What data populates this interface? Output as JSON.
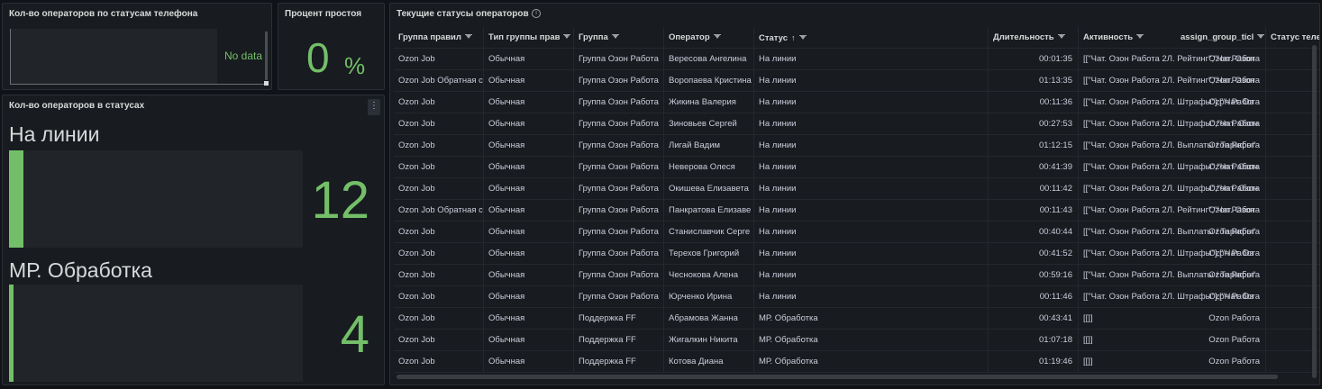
{
  "panels": {
    "phone_status": {
      "title": "Кол-во операторов по статусам телефона",
      "no_data": "No data"
    },
    "idle_percent": {
      "title": "Процент простоя",
      "value": "0",
      "unit": "%"
    },
    "status_counts": {
      "title": "Кол-во операторов в статусах",
      "menu_icon": "kebab-menu-icon",
      "gauges": [
        {
          "label": "На линии",
          "value": "12",
          "fill_fraction": 0.05
        },
        {
          "label": "МР. Обработка",
          "value": "4",
          "fill_fraction": 0.016
        }
      ]
    },
    "operators_table": {
      "title": "Текущие статусы операторов",
      "info_icon": "info-icon",
      "columns": [
        {
          "label": "Группа правил",
          "filter": true
        },
        {
          "label": "Тип группы прав",
          "filter": true
        },
        {
          "label": "Группа",
          "filter": true
        },
        {
          "label": "Оператор",
          "filter": true
        },
        {
          "label": "Статус",
          "filter": true,
          "sort": "↑"
        },
        {
          "label": "Длительность",
          "filter": true
        },
        {
          "label": "Активность",
          "filter": true
        },
        {
          "label": "assign_group_ticl",
          "filter": true
        },
        {
          "label": "Статус теле",
          "filter": false
        }
      ],
      "rows": [
        [
          "Ozon Job",
          "Обычная",
          "Группа Озон Работа",
          "Вересова Ангелина",
          "На линии",
          "00:01:35",
          "[[\"Чат. Озон Работа 2Л. Рейтинг\",\"Чат. Озон",
          "Ozon Работа",
          ""
        ],
        [
          "Ozon Job Обратная с",
          "Обычная",
          "Группа Озон Работа",
          "Воропаева Кристина",
          "На линии",
          "01:13:35",
          "[[\"Чат. Озон Работа 2Л. Рейтинг\",\"Чат. Озон",
          "Ozon Работа",
          ""
        ],
        [
          "Ozon Job",
          "Обычная",
          "Группа Озон Работа",
          "Жикина Валерия",
          "На линии",
          "00:11:36",
          "[[\"Чат. Озон Работа 2Л. Штрафы\"],[\"Чат. Оз",
          "Ozon Работа",
          ""
        ],
        [
          "Ozon Job",
          "Обычная",
          "Группа Озон Работа",
          "Зиновьев Сергей",
          "На линии",
          "00:27:53",
          "[[\"Чат. Озон Работа 2Л. Штрафы\",\"Чат. Озон",
          "Ozon Работа",
          ""
        ],
        [
          "Ozon Job",
          "Обычная",
          "Группа Озон Работа",
          "Лигай Вадим",
          "На линии",
          "01:12:15",
          "[[\"Чат. Озон Работа 2Л. Выплаты / Тарифы\"",
          "Ozon Работа",
          ""
        ],
        [
          "Ozon Job",
          "Обычная",
          "Группа Озон Работа",
          "Неверова Олеся",
          "На линии",
          "00:41:39",
          "[[\"Чат. Озон Работа 2Л. Штрафы\",\"Чат. Озон",
          "Ozon Работа",
          ""
        ],
        [
          "Ozon Job",
          "Обычная",
          "Группа Озон Работа",
          "Окишева Елизавета",
          "На линии",
          "00:11:42",
          "[[\"Чат. Озон Работа 2Л. Штрафы\",\"Чат. Озон",
          "Ozon Работа",
          ""
        ],
        [
          "Ozon Job Обратная с",
          "Обычная",
          "Группа Озон Работа",
          "Панкратова Елизаве",
          "На линии",
          "00:11:43",
          "[[\"Чат. Озон Работа 2Л. Рейтинг\",\"Чат. Озон",
          "Ozon Работа",
          ""
        ],
        [
          "Ozon Job",
          "Обычная",
          "Группа Озон Работа",
          "Станиславчик Серге",
          "На линии",
          "00:40:44",
          "[[\"Чат. Озон Работа 2Л. Выплаты / Тарифы\"",
          "Ozon Работа",
          ""
        ],
        [
          "Ozon Job",
          "Обычная",
          "Группа Озон Работа",
          "Терехов Григорий",
          "На линии",
          "00:41:52",
          "[[\"Чат. Озон Работа 2Л. Штрафы\"],[\"Чат. Оз",
          "Ozon Работа",
          ""
        ],
        [
          "Ozon Job",
          "Обычная",
          "Группа Озон Работа",
          "Чеснокова Алена",
          "На линии",
          "00:59:16",
          "[[\"Чат. Озон Работа 2Л. Выплаты / Тарифы\"",
          "Ozon Работа",
          ""
        ],
        [
          "Ozon Job",
          "Обычная",
          "Группа Озон Работа",
          "Юрченко Ирина",
          "На линии",
          "00:11:46",
          "[[\"Чат. Озон Работа 2Л. Штрафы\"],[\"Чат. Оз",
          "Ozon Работа",
          ""
        ],
        [
          "Ozon Job",
          "Обычная",
          "Поддержка FF",
          "Абрамова Жанна",
          "МР. Обработка",
          "00:43:41",
          "[[]]",
          "Ozon Работа",
          ""
        ],
        [
          "Ozon Job",
          "Обычная",
          "Поддержка FF",
          "Жигалкин Никита",
          "МР. Обработка",
          "01:07:18",
          "[[]]",
          "Ozon Работа",
          ""
        ],
        [
          "Ozon Job",
          "Обычная",
          "Поддержка FF",
          "Котова Диана",
          "МР. Обработка",
          "01:19:46",
          "[[]]",
          "Ozon Работа",
          ""
        ]
      ]
    }
  },
  "colors": {
    "accent_green": "#73bf69",
    "panel_bg": "#181b1f",
    "page_bg": "#111217"
  }
}
